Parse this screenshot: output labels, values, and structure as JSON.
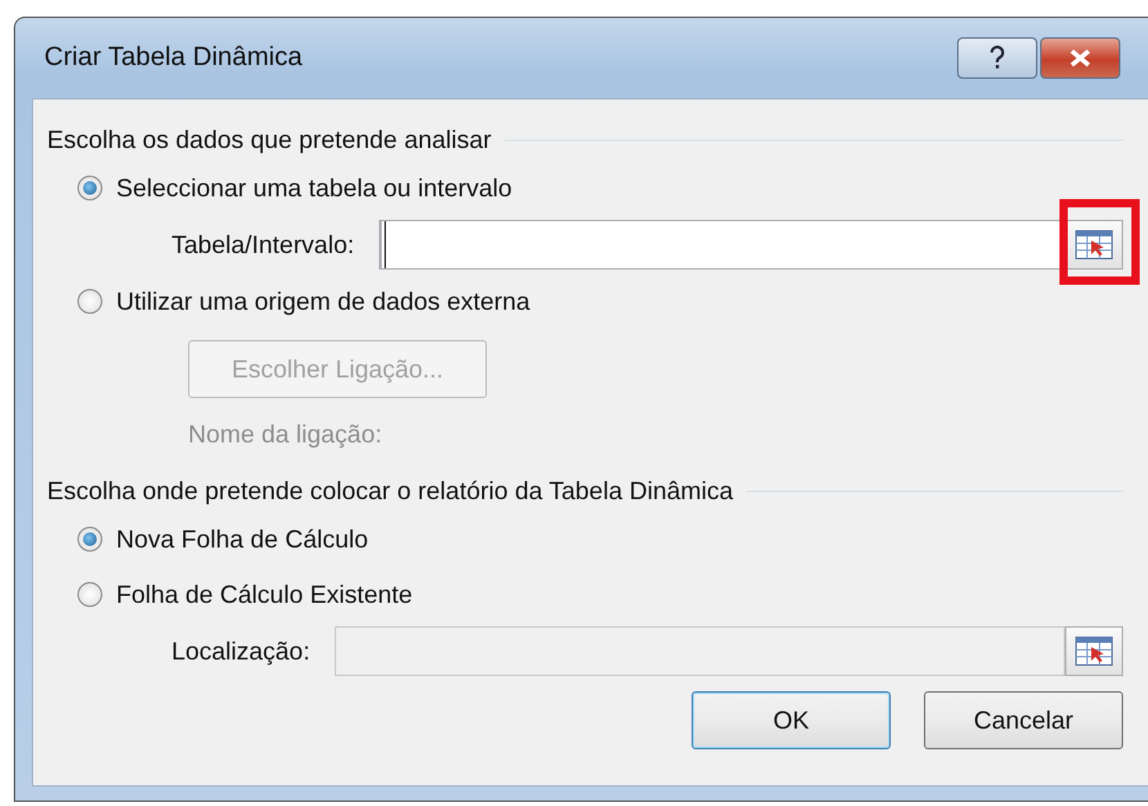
{
  "window": {
    "title": "Criar Tabela Dinâmica"
  },
  "sections": [
    {
      "title": "Escolha os dados que pretende analisar",
      "options": [
        {
          "label": "Seleccionar uma tabela ou intervalo",
          "selected": true,
          "kind": "field",
          "field": {
            "label": "Tabela/Intervalo:",
            "disabled": false,
            "focused": true,
            "highlighted": true
          }
        },
        {
          "label": "Utilizar uma origem de dados externa",
          "selected": false,
          "kind": "connection",
          "button": {
            "label": "Escolher Ligação...",
            "disabled": true
          },
          "note": {
            "label": "Nome da ligação:",
            "disabled": true
          }
        }
      ]
    },
    {
      "title": "Escolha onde pretende colocar o relatório da Tabela Dinâmica",
      "options": [
        {
          "label": "Nova Folha de Cálculo",
          "selected": true,
          "kind": "plain"
        },
        {
          "label": "Folha de Cálculo Existente",
          "selected": false,
          "kind": "plain"
        }
      ],
      "field": {
        "label": "Localização:",
        "disabled": true,
        "focused": false
      }
    }
  ],
  "buttons": [
    {
      "label": "OK",
      "default": true
    },
    {
      "label": "Cancelar",
      "default": false
    }
  ]
}
